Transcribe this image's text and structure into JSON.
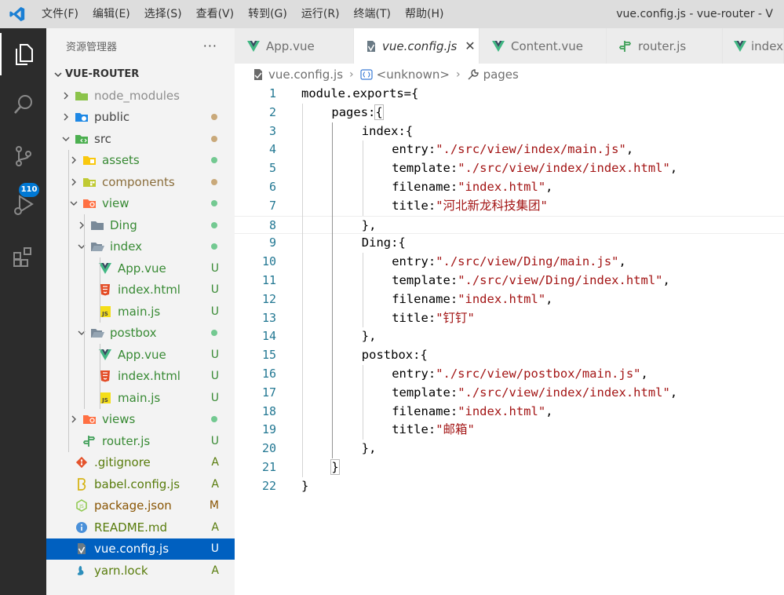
{
  "window": {
    "title": "vue.config.js - vue-router - V"
  },
  "menu": [
    "文件(F)",
    "编辑(E)",
    "选择(S)",
    "查看(V)",
    "转到(G)",
    "运行(R)",
    "终端(T)",
    "帮助(H)"
  ],
  "activity_bar": {
    "scm_badge": "110"
  },
  "sidebar": {
    "title": "资源管理器",
    "more": "···",
    "folder": "VUE-ROUTER",
    "tree": [
      {
        "name": "node_modules",
        "depth": 0,
        "kind": "folder",
        "icon": "node-folder-icon",
        "status": "",
        "dot": "",
        "color": "#8e8e8e",
        "open": false
      },
      {
        "name": "public",
        "depth": 0,
        "kind": "folder",
        "icon": "public-folder-icon",
        "status": "",
        "dot": "#c9a97a",
        "color": "#444444",
        "open": false
      },
      {
        "name": "src",
        "depth": 0,
        "kind": "folder",
        "icon": "src-folder-icon",
        "status": "",
        "dot": "#c9a97a",
        "color": "#444444",
        "open": true
      },
      {
        "name": "assets",
        "depth": 1,
        "kind": "folder",
        "icon": "assets-folder-icon",
        "status": "",
        "dot": "#73c991",
        "color": "#388a34",
        "open": false
      },
      {
        "name": "components",
        "depth": 1,
        "kind": "folder",
        "icon": "components-folder-icon",
        "status": "",
        "dot": "#c9a97a",
        "color": "#8a6d3b",
        "open": false
      },
      {
        "name": "view",
        "depth": 1,
        "kind": "folder",
        "icon": "view-folder-icon",
        "status": "",
        "dot": "#73c991",
        "color": "#388a34",
        "open": true
      },
      {
        "name": "Ding",
        "depth": 2,
        "kind": "folder",
        "icon": "folder-icon",
        "status": "",
        "dot": "#73c991",
        "color": "#388a34",
        "open": false
      },
      {
        "name": "index",
        "depth": 2,
        "kind": "folder",
        "icon": "folder-open-icon",
        "status": "",
        "dot": "#73c991",
        "color": "#388a34",
        "open": true
      },
      {
        "name": "App.vue",
        "depth": 3,
        "kind": "file",
        "icon": "vue-icon",
        "status": "U",
        "dot": "",
        "color": "#388a34",
        "open": false
      },
      {
        "name": "index.html",
        "depth": 3,
        "kind": "file",
        "icon": "html-icon",
        "status": "U",
        "dot": "",
        "color": "#388a34",
        "open": false
      },
      {
        "name": "main.js",
        "depth": 3,
        "kind": "file",
        "icon": "js-icon",
        "status": "U",
        "dot": "",
        "color": "#388a34",
        "open": false
      },
      {
        "name": "postbox",
        "depth": 2,
        "kind": "folder",
        "icon": "folder-open-icon",
        "status": "",
        "dot": "#73c991",
        "color": "#388a34",
        "open": true
      },
      {
        "name": "App.vue",
        "depth": 3,
        "kind": "file",
        "icon": "vue-icon",
        "status": "U",
        "dot": "",
        "color": "#388a34",
        "open": false
      },
      {
        "name": "index.html",
        "depth": 3,
        "kind": "file",
        "icon": "html-icon",
        "status": "U",
        "dot": "",
        "color": "#388a34",
        "open": false
      },
      {
        "name": "main.js",
        "depth": 3,
        "kind": "file",
        "icon": "js-icon",
        "status": "U",
        "dot": "",
        "color": "#388a34",
        "open": false
      },
      {
        "name": "views",
        "depth": 1,
        "kind": "folder",
        "icon": "views-folder-icon",
        "status": "",
        "dot": "#73c991",
        "color": "#388a34",
        "open": false
      },
      {
        "name": "router.js",
        "depth": 1,
        "kind": "file",
        "icon": "router-icon",
        "status": "U",
        "dot": "",
        "color": "#388a34",
        "open": false
      },
      {
        "name": ".gitignore",
        "depth": 0,
        "kind": "file",
        "icon": "git-icon",
        "status": "A",
        "dot": "",
        "color": "#587c0c",
        "open": false
      },
      {
        "name": "babel.config.js",
        "depth": 0,
        "kind": "file",
        "icon": "babel-icon",
        "status": "A",
        "dot": "",
        "color": "#587c0c",
        "open": false
      },
      {
        "name": "package.json",
        "depth": 0,
        "kind": "file",
        "icon": "nodejs-icon",
        "status": "M",
        "dot": "",
        "color": "#895503",
        "open": false
      },
      {
        "name": "README.md",
        "depth": 0,
        "kind": "file",
        "icon": "info-icon",
        "status": "A",
        "dot": "",
        "color": "#587c0c",
        "open": false
      },
      {
        "name": "vue.config.js",
        "depth": 0,
        "kind": "file",
        "icon": "vue-config-icon",
        "status": "U",
        "dot": "",
        "color": "#ffffff",
        "open": false,
        "selected": true
      },
      {
        "name": "yarn.lock",
        "depth": 0,
        "kind": "file",
        "icon": "yarn-icon",
        "status": "A",
        "dot": "",
        "color": "#587c0c",
        "open": false
      }
    ]
  },
  "tabs": [
    {
      "label": "App.vue",
      "icon": "vue-icon",
      "active": false
    },
    {
      "label": "vue.config.js",
      "icon": "vue-config-icon",
      "active": true,
      "close": "✕"
    },
    {
      "label": "Content.vue",
      "icon": "vue-icon",
      "active": false
    },
    {
      "label": "router.js",
      "icon": "router-icon",
      "active": false
    },
    {
      "label": "index",
      "icon": "vue-icon",
      "active": false
    }
  ],
  "breadcrumb": [
    "vue.config.js",
    "<unknown>",
    "pages"
  ],
  "editor": {
    "current_line": 8,
    "lines": [
      {
        "n": "1",
        "indent": 0,
        "parts": [
          [
            "module.exports={",
            "p"
          ]
        ]
      },
      {
        "n": "2",
        "indent": 1,
        "parts": [
          [
            "pages:",
            "p"
          ],
          [
            "{",
            "b"
          ]
        ]
      },
      {
        "n": "3",
        "indent": 2,
        "parts": [
          [
            "index:{",
            "p"
          ]
        ]
      },
      {
        "n": "4",
        "indent": 3,
        "parts": [
          [
            "entry:",
            "p"
          ],
          [
            "\"./src/view/index/main.js\"",
            "s"
          ],
          [
            ",",
            "p"
          ]
        ]
      },
      {
        "n": "5",
        "indent": 3,
        "parts": [
          [
            "template:",
            "p"
          ],
          [
            "\"./src/view/index/index.html\"",
            "s"
          ],
          [
            ",",
            "p"
          ]
        ]
      },
      {
        "n": "6",
        "indent": 3,
        "parts": [
          [
            "filename:",
            "p"
          ],
          [
            "\"index.html\"",
            "s"
          ],
          [
            ",",
            "p"
          ]
        ]
      },
      {
        "n": "7",
        "indent": 3,
        "parts": [
          [
            "title:",
            "p"
          ],
          [
            "\"河北新龙科技集团\"",
            "s"
          ]
        ]
      },
      {
        "n": "8",
        "indent": 2,
        "parts": [
          [
            "},",
            "p"
          ]
        ]
      },
      {
        "n": "9",
        "indent": 2,
        "parts": [
          [
            "Ding:{",
            "p"
          ]
        ]
      },
      {
        "n": "10",
        "indent": 3,
        "parts": [
          [
            "entry:",
            "p"
          ],
          [
            "\"./src/view/Ding/main.js\"",
            "s"
          ],
          [
            ",",
            "p"
          ]
        ]
      },
      {
        "n": "11",
        "indent": 3,
        "parts": [
          [
            "template:",
            "p"
          ],
          [
            "\"./src/view/Ding/index.html\"",
            "s"
          ],
          [
            ",",
            "p"
          ]
        ]
      },
      {
        "n": "12",
        "indent": 3,
        "parts": [
          [
            "filename:",
            "p"
          ],
          [
            "\"index.html\"",
            "s"
          ],
          [
            ",",
            "p"
          ]
        ]
      },
      {
        "n": "13",
        "indent": 3,
        "parts": [
          [
            "title:",
            "p"
          ],
          [
            "\"钉钉\"",
            "s"
          ]
        ]
      },
      {
        "n": "14",
        "indent": 2,
        "parts": [
          [
            "},",
            "p"
          ]
        ]
      },
      {
        "n": "15",
        "indent": 2,
        "parts": [
          [
            "postbox:{",
            "p"
          ]
        ]
      },
      {
        "n": "16",
        "indent": 3,
        "parts": [
          [
            "entry:",
            "p"
          ],
          [
            "\"./src/view/postbox/main.js\"",
            "s"
          ],
          [
            ",",
            "p"
          ]
        ]
      },
      {
        "n": "17",
        "indent": 3,
        "parts": [
          [
            "template:",
            "p"
          ],
          [
            "\"./src/view/index/index.html\"",
            "s"
          ],
          [
            ",",
            "p"
          ]
        ]
      },
      {
        "n": "18",
        "indent": 3,
        "parts": [
          [
            "filename:",
            "p"
          ],
          [
            "\"index.html\"",
            "s"
          ],
          [
            ",",
            "p"
          ]
        ]
      },
      {
        "n": "19",
        "indent": 3,
        "parts": [
          [
            "title:",
            "p"
          ],
          [
            "\"邮箱\"",
            "s"
          ]
        ]
      },
      {
        "n": "20",
        "indent": 2,
        "parts": [
          [
            "},",
            "p"
          ]
        ]
      },
      {
        "n": "21",
        "indent": 1,
        "parts": [
          [
            "}",
            "b"
          ]
        ]
      },
      {
        "n": "22",
        "indent": 0,
        "parts": [
          [
            "}",
            "p"
          ]
        ]
      }
    ]
  }
}
